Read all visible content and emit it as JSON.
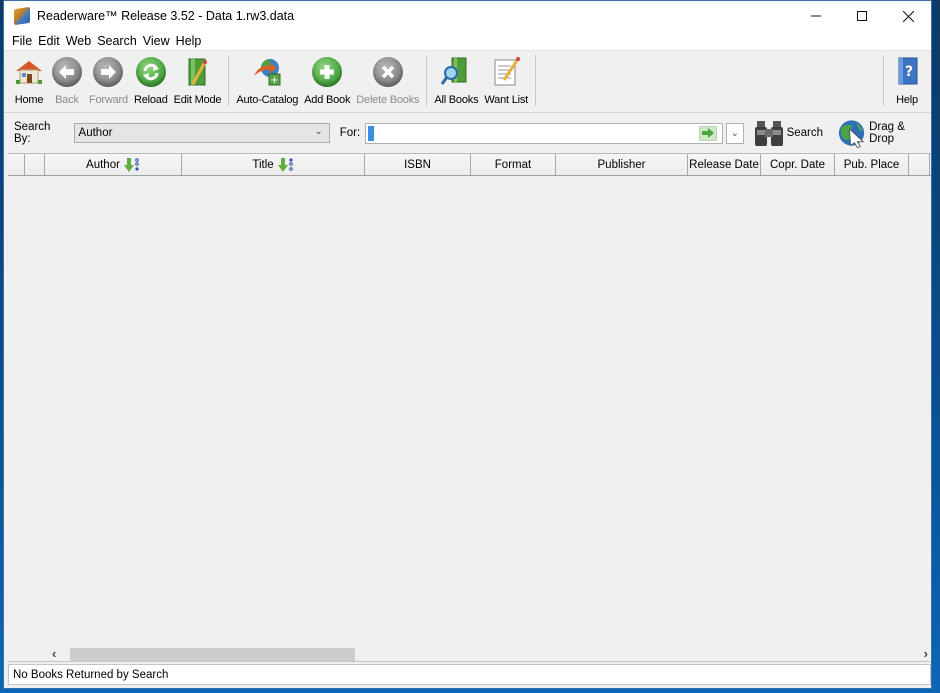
{
  "window": {
    "title": "Readerware™ Release 3.52 - Data 1.rw3.data",
    "controls": {
      "minimize": "minimize",
      "maximize": "maximize",
      "close": "close"
    }
  },
  "menubar": [
    "File",
    "Edit",
    "Web",
    "Search",
    "View",
    "Help"
  ],
  "toolbar": {
    "home": {
      "label": "Home",
      "icon": "house-icon",
      "enabled": true
    },
    "back": {
      "label": "Back",
      "icon": "arrow-left-icon",
      "enabled": false
    },
    "forward": {
      "label": "Forward",
      "icon": "arrow-right-icon",
      "enabled": false
    },
    "reload": {
      "label": "Reload",
      "icon": "reload-icon",
      "enabled": true
    },
    "edit_mode": {
      "label": "Edit Mode",
      "icon": "edit-book-icon",
      "enabled": true
    },
    "auto_catalog": {
      "label": "Auto-Catalog",
      "icon": "auto-catalog-icon",
      "enabled": true
    },
    "add_book": {
      "label": "Add Book",
      "icon": "plus-icon",
      "enabled": true
    },
    "delete_books": {
      "label": "Delete Books",
      "icon": "x-icon",
      "enabled": false
    },
    "all_books": {
      "label": "All Books",
      "icon": "books-search-icon",
      "enabled": true
    },
    "want_list": {
      "label": "Want List",
      "icon": "notepad-icon",
      "enabled": true
    },
    "help": {
      "label": "Help",
      "icon": "help-book-icon",
      "enabled": true
    }
  },
  "search": {
    "search_by_label": "Search By:",
    "search_by_value": "Author",
    "for_label": "For:",
    "for_value": "",
    "search_button": "Search",
    "drag_drop_button": "Drag & Drop"
  },
  "table": {
    "columns": [
      "",
      "",
      "Author",
      "Title",
      "ISBN",
      "Format",
      "Publisher",
      "Release Date",
      "Copr. Date",
      "Pub. Place",
      ""
    ],
    "sorted_columns": [
      "Author",
      "Title"
    ],
    "rows": []
  },
  "status": "No Books Returned by Search",
  "colors": {
    "accent_green": "#3f9e37",
    "disabled_text": "#8a8a8a",
    "selection_blue": "#3b8fe0"
  }
}
